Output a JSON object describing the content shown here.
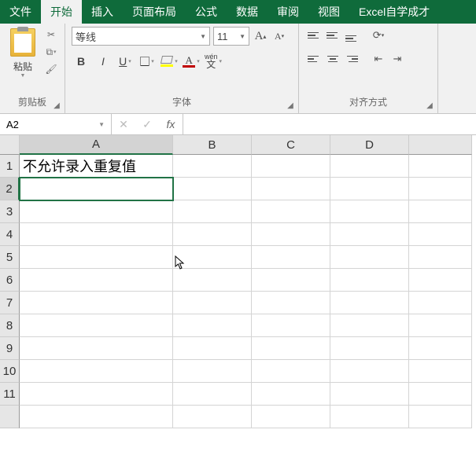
{
  "tabs": {
    "file": "文件",
    "home": "开始",
    "insert": "插入",
    "layout": "页面布局",
    "formula": "公式",
    "data": "数据",
    "review": "审阅",
    "view": "视图",
    "addin": "Excel自学成才"
  },
  "clipboard": {
    "paste": "粘贴",
    "group": "剪贴板"
  },
  "font": {
    "name": "等线",
    "size": "11",
    "group": "字体",
    "bold": "B",
    "italic": "I",
    "underline": "U",
    "wen": "wén",
    "wen_cn": "文"
  },
  "align": {
    "group": "对齐方式"
  },
  "fbar": {
    "name": "A2",
    "fx": "fx",
    "value": ""
  },
  "cols": [
    "A",
    "B",
    "C",
    "D"
  ],
  "rows": [
    "1",
    "2",
    "3",
    "4",
    "5",
    "6",
    "7",
    "8",
    "9",
    "10",
    "11"
  ],
  "cells": {
    "A1": "不允许录入重复值"
  },
  "active": "A2"
}
